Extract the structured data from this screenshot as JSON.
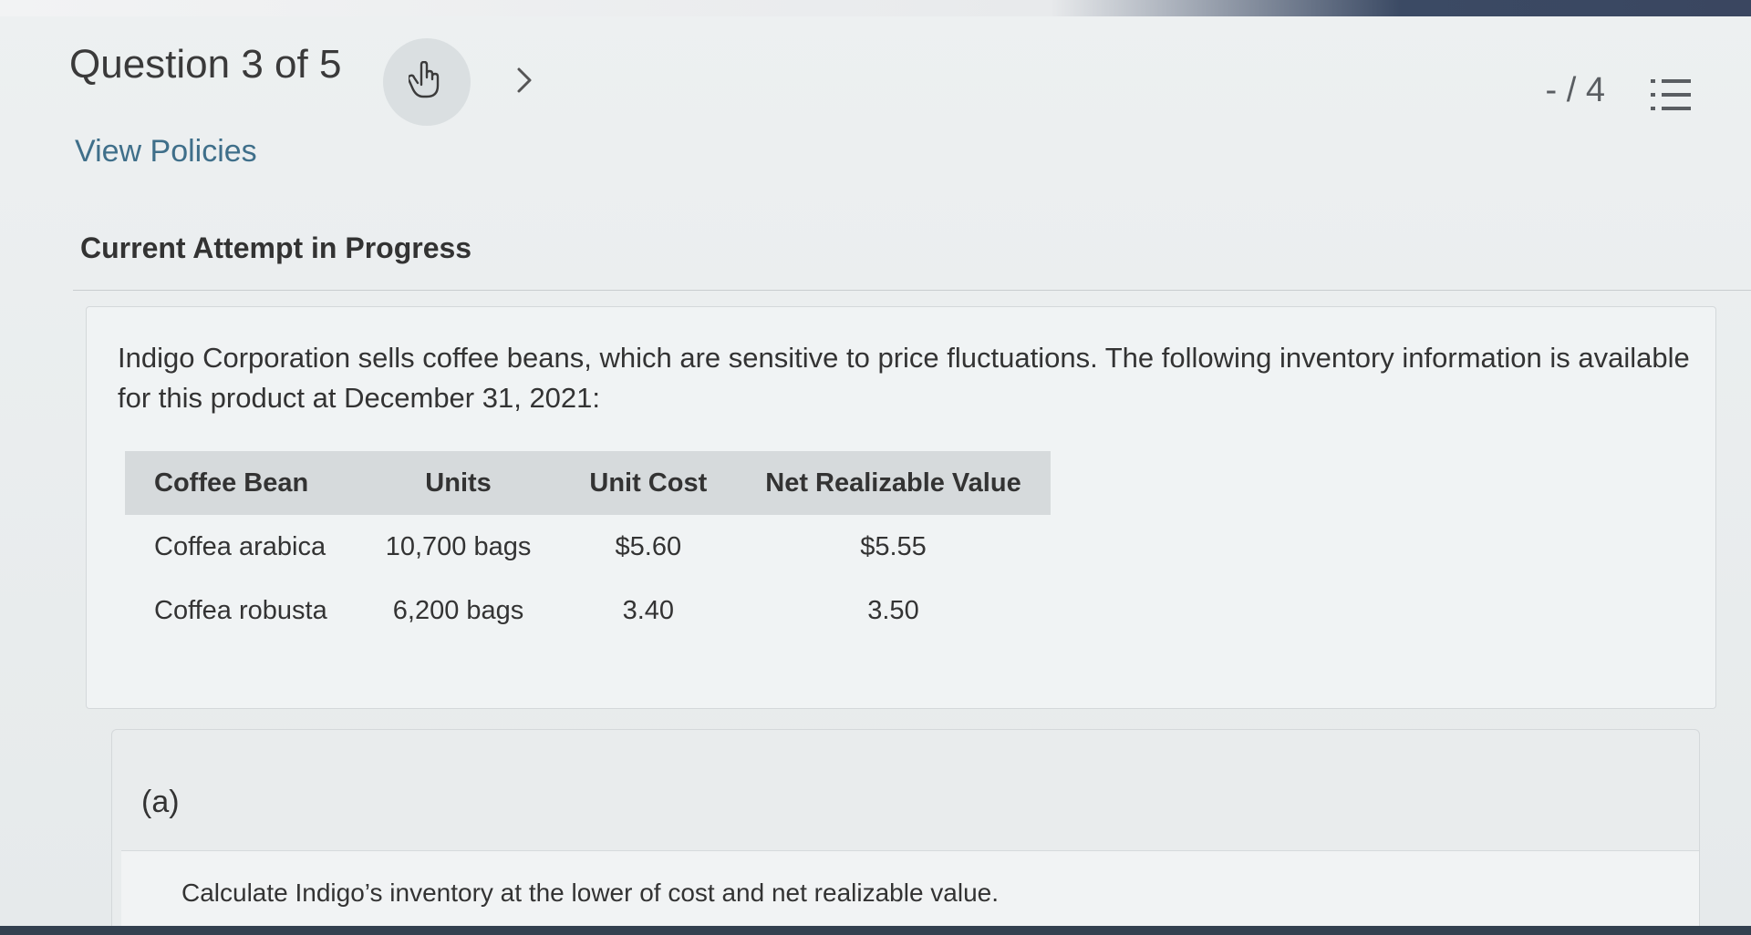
{
  "header": {
    "question_title": "Question 3 of 5",
    "score": "- / 4",
    "icons": {
      "hand": "hand-pointer-icon",
      "next": "chevron-right-icon",
      "list": "numbered-list-icon"
    }
  },
  "links": {
    "policies": "View Policies"
  },
  "status": {
    "attempt": "Current Attempt in Progress"
  },
  "problem": {
    "intro": "Indigo Corporation sells coffee beans, which are sensitive to price fluctuations. The following inventory information is available for this product at December 31, 2021:",
    "table": {
      "headers": [
        "Coffee Bean",
        "Units",
        "Unit Cost",
        "Net Realizable Value"
      ],
      "rows": [
        [
          "Coffea arabica",
          "10,700 bags",
          "$5.60",
          "$5.55"
        ],
        [
          "Coffea robusta",
          "6,200 bags",
          "3.40",
          "3.50"
        ]
      ]
    }
  },
  "part_a": {
    "label": "(a)",
    "instruction": "Calculate Indigo’s inventory at the lower of cost and net realizable value."
  },
  "colors": {
    "link": "#3f6f8a",
    "table_header_bg": "#d6dadc",
    "background": "#e9edee"
  }
}
